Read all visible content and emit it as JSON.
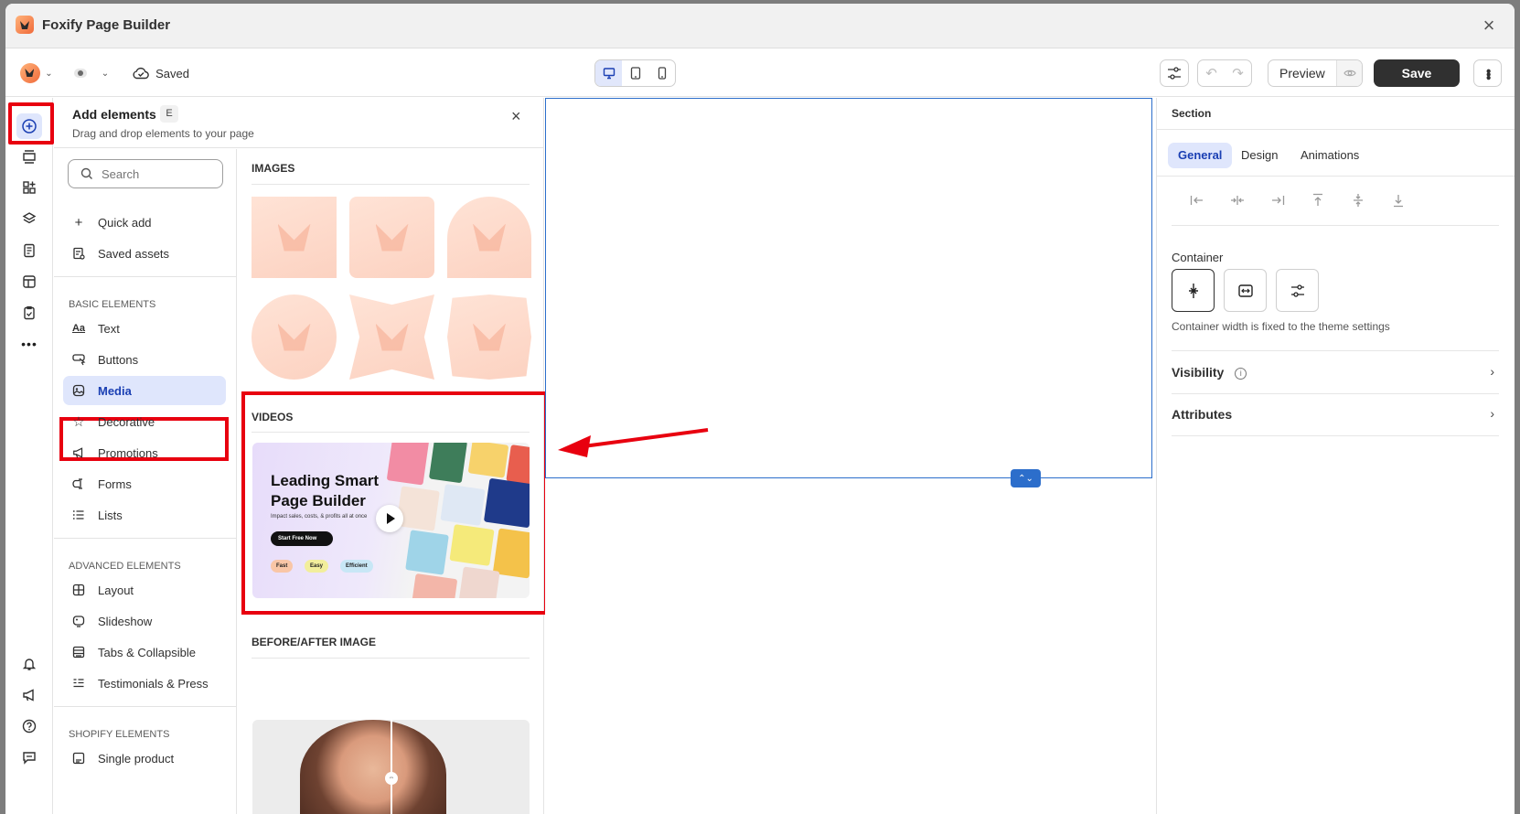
{
  "window": {
    "title": "Foxify Page Builder"
  },
  "toolbar": {
    "status": "Saved",
    "preview_label": "Preview",
    "save_label": "Save"
  },
  "add_panel": {
    "title": "Add elements",
    "shortcut": "E",
    "subtitle": "Drag and drop elements to your page",
    "search_placeholder": "Search",
    "top_items": [
      {
        "label": "Quick add",
        "icon": "plus-icon"
      },
      {
        "label": "Saved assets",
        "icon": "saved-assets-icon"
      }
    ],
    "basic_heading": "BASIC ELEMENTS",
    "basic_items": [
      {
        "label": "Text",
        "icon": "text-icon"
      },
      {
        "label": "Buttons",
        "icon": "button-cursor-icon"
      },
      {
        "label": "Media",
        "icon": "media-icon"
      },
      {
        "label": "Decorative",
        "icon": "star-icon"
      },
      {
        "label": "Promotions",
        "icon": "megaphone-icon"
      },
      {
        "label": "Forms",
        "icon": "form-icon"
      },
      {
        "label": "Lists",
        "icon": "list-icon"
      }
    ],
    "advanced_heading": "ADVANCED ELEMENTS",
    "advanced_items": [
      {
        "label": "Layout",
        "icon": "layout-grid-icon"
      },
      {
        "label": "Slideshow",
        "icon": "slideshow-icon"
      },
      {
        "label": "Tabs & Collapsible",
        "icon": "tabs-icon"
      },
      {
        "label": "Testimonials & Press",
        "icon": "testimonials-icon"
      }
    ],
    "shopify_heading": "SHOPIFY ELEMENTS",
    "shopify_items": [
      {
        "label": "Single product",
        "icon": "product-icon"
      }
    ],
    "groups": {
      "images": "IMAGES",
      "videos": "VIDEOS",
      "before_after": "BEFORE/AFTER IMAGE"
    },
    "video_thumb": {
      "headline": "Leading Smart Page Builder",
      "sub": "Impact sales, costs, & profits all at once",
      "cta": "Start Free Now",
      "pills": [
        "Fast",
        "Easy",
        "Efficient"
      ]
    }
  },
  "right_panel": {
    "title": "Section",
    "tabs": [
      "General",
      "Design",
      "Animations"
    ],
    "container_label": "Container",
    "container_help": "Container width is fixed to the theme settings",
    "visibility_label": "Visibility",
    "attributes_label": "Attributes"
  },
  "colors": {
    "accent": "#2c6ecb",
    "highlight": "#e8000f",
    "active_bg": "#dfe6fc"
  }
}
